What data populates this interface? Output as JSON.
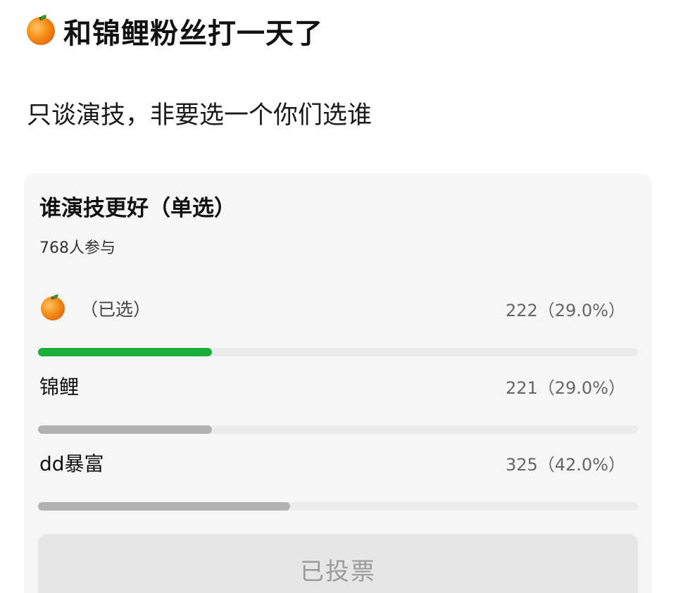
{
  "post": {
    "title": "和锦鲤粉丝打一天了",
    "title_icon": "tangerine-emoji",
    "body": "只谈演技，非要选一个你们选谁"
  },
  "poll": {
    "question": "谁演技更好（单选）",
    "participants": "768人参与",
    "options": [
      {
        "label": "",
        "icon": "tangerine-emoji",
        "selected_tag": "（已选）",
        "count": "222（29.0%）",
        "percent": 29.0,
        "bar_color": "#1aad3a",
        "selected": true
      },
      {
        "label": "锦鲤",
        "count": "221（29.0%）",
        "percent": 29.0,
        "bar_color": "#b2b2b2",
        "selected": false
      },
      {
        "label": "dd暴富",
        "count": "325（42.0%）",
        "percent": 42.0,
        "bar_color": "#b2b2b2",
        "selected": false
      }
    ],
    "vote_button": "已投票"
  }
}
